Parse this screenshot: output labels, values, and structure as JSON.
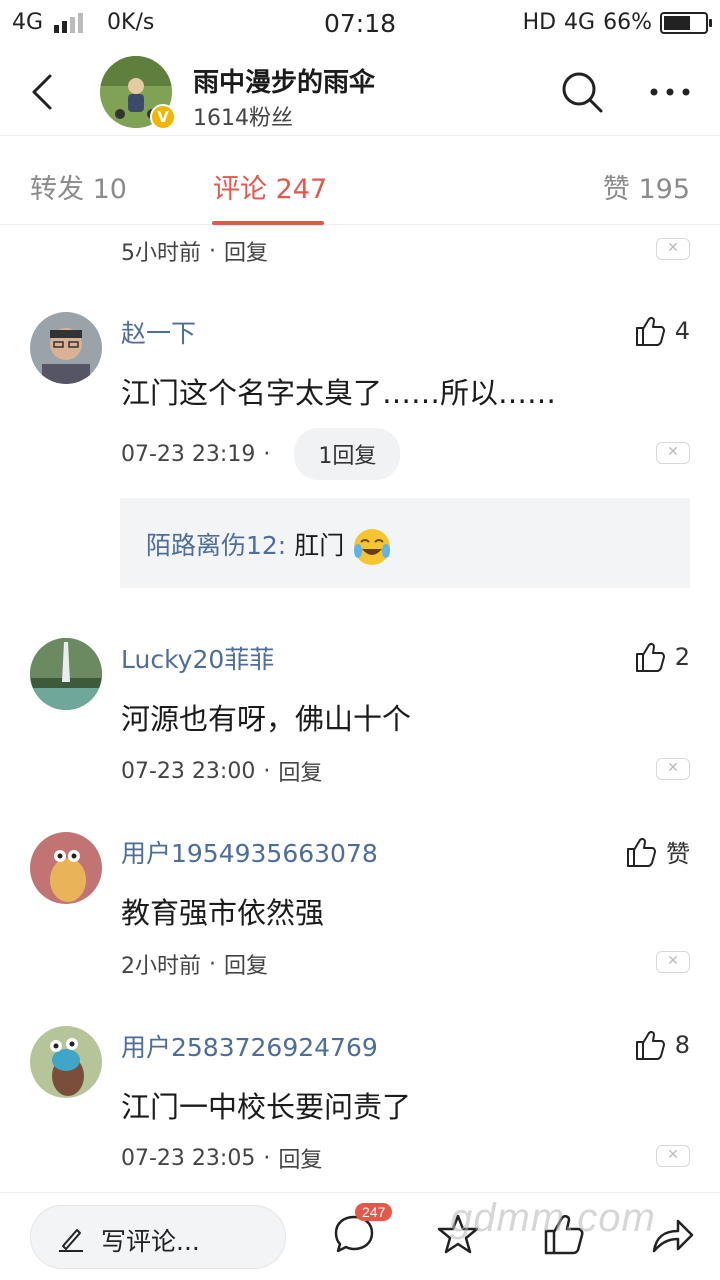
{
  "status_bar": {
    "network": "4G",
    "speed": "0K/s",
    "time": "07:18",
    "hd": "HD",
    "network_right": "4G",
    "battery_text": "66%",
    "battery_level": 0.66
  },
  "header": {
    "username": "雨中漫步的雨伞",
    "followers": "1614粉丝",
    "verified_mark": "V",
    "icons": {
      "back": "back-arrow-icon",
      "search": "search-icon",
      "more": "more-icon"
    }
  },
  "tabs": [
    {
      "label": "转发 10"
    },
    {
      "label": "评论 247",
      "active": true
    },
    {
      "label": "赞 195"
    }
  ],
  "truncated_meta": {
    "time": "5小时前",
    "reply": "回复"
  },
  "comments": [
    {
      "name": "赵一下",
      "likes": "4",
      "text": "江门这个名字太臭了……所以……",
      "time": "07-23 23:19",
      "reply_count": "1回复",
      "sub_reply": {
        "name": "陌路离伤12:",
        "text": " 肛门"
      }
    },
    {
      "name": "Lucky20菲菲",
      "likes": "2",
      "text": "河源也有呀，佛山十个",
      "time": "07-23 23:00",
      "reply": "回复"
    },
    {
      "name": "用户1954935663078",
      "likes": "赞",
      "text": "教育强市依然强",
      "time": "2小时前",
      "reply": "回复"
    },
    {
      "name": "用户2583726924769",
      "likes": "8",
      "text": "江门一中校长要问责了",
      "time": "07-23 23:05",
      "reply": "回复"
    }
  ],
  "bottom_bar": {
    "input_placeholder": "写评论...",
    "comment_badge": "247",
    "icons": [
      "comment-icon",
      "star-icon",
      "thumbs-up-icon",
      "share-icon"
    ]
  },
  "watermark": "gdmm.com",
  "colors": {
    "accent": "#e5574a",
    "name_blue": "#4d6d9a"
  }
}
